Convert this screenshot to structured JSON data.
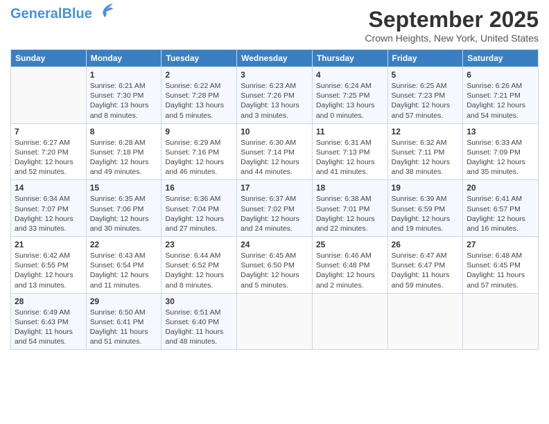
{
  "header": {
    "logo_general": "General",
    "logo_blue": "Blue",
    "month_year": "September 2025",
    "location": "Crown Heights, New York, United States"
  },
  "days_of_week": [
    "Sunday",
    "Monday",
    "Tuesday",
    "Wednesday",
    "Thursday",
    "Friday",
    "Saturday"
  ],
  "weeks": [
    [
      {
        "day": "",
        "info": ""
      },
      {
        "day": "1",
        "info": "Sunrise: 6:21 AM\nSunset: 7:30 PM\nDaylight: 13 hours\nand 8 minutes."
      },
      {
        "day": "2",
        "info": "Sunrise: 6:22 AM\nSunset: 7:28 PM\nDaylight: 13 hours\nand 5 minutes."
      },
      {
        "day": "3",
        "info": "Sunrise: 6:23 AM\nSunset: 7:26 PM\nDaylight: 13 hours\nand 3 minutes."
      },
      {
        "day": "4",
        "info": "Sunrise: 6:24 AM\nSunset: 7:25 PM\nDaylight: 13 hours\nand 0 minutes."
      },
      {
        "day": "5",
        "info": "Sunrise: 6:25 AM\nSunset: 7:23 PM\nDaylight: 12 hours\nand 57 minutes."
      },
      {
        "day": "6",
        "info": "Sunrise: 6:26 AM\nSunset: 7:21 PM\nDaylight: 12 hours\nand 54 minutes."
      }
    ],
    [
      {
        "day": "7",
        "info": "Sunrise: 6:27 AM\nSunset: 7:20 PM\nDaylight: 12 hours\nand 52 minutes."
      },
      {
        "day": "8",
        "info": "Sunrise: 6:28 AM\nSunset: 7:18 PM\nDaylight: 12 hours\nand 49 minutes."
      },
      {
        "day": "9",
        "info": "Sunrise: 6:29 AM\nSunset: 7:16 PM\nDaylight: 12 hours\nand 46 minutes."
      },
      {
        "day": "10",
        "info": "Sunrise: 6:30 AM\nSunset: 7:14 PM\nDaylight: 12 hours\nand 44 minutes."
      },
      {
        "day": "11",
        "info": "Sunrise: 6:31 AM\nSunset: 7:13 PM\nDaylight: 12 hours\nand 41 minutes."
      },
      {
        "day": "12",
        "info": "Sunrise: 6:32 AM\nSunset: 7:11 PM\nDaylight: 12 hours\nand 38 minutes."
      },
      {
        "day": "13",
        "info": "Sunrise: 6:33 AM\nSunset: 7:09 PM\nDaylight: 12 hours\nand 35 minutes."
      }
    ],
    [
      {
        "day": "14",
        "info": "Sunrise: 6:34 AM\nSunset: 7:07 PM\nDaylight: 12 hours\nand 33 minutes."
      },
      {
        "day": "15",
        "info": "Sunrise: 6:35 AM\nSunset: 7:06 PM\nDaylight: 12 hours\nand 30 minutes."
      },
      {
        "day": "16",
        "info": "Sunrise: 6:36 AM\nSunset: 7:04 PM\nDaylight: 12 hours\nand 27 minutes."
      },
      {
        "day": "17",
        "info": "Sunrise: 6:37 AM\nSunset: 7:02 PM\nDaylight: 12 hours\nand 24 minutes."
      },
      {
        "day": "18",
        "info": "Sunrise: 6:38 AM\nSunset: 7:01 PM\nDaylight: 12 hours\nand 22 minutes."
      },
      {
        "day": "19",
        "info": "Sunrise: 6:39 AM\nSunset: 6:59 PM\nDaylight: 12 hours\nand 19 minutes."
      },
      {
        "day": "20",
        "info": "Sunrise: 6:41 AM\nSunset: 6:57 PM\nDaylight: 12 hours\nand 16 minutes."
      }
    ],
    [
      {
        "day": "21",
        "info": "Sunrise: 6:42 AM\nSunset: 6:55 PM\nDaylight: 12 hours\nand 13 minutes."
      },
      {
        "day": "22",
        "info": "Sunrise: 6:43 AM\nSunset: 6:54 PM\nDaylight: 12 hours\nand 11 minutes."
      },
      {
        "day": "23",
        "info": "Sunrise: 6:44 AM\nSunset: 6:52 PM\nDaylight: 12 hours\nand 8 minutes."
      },
      {
        "day": "24",
        "info": "Sunrise: 6:45 AM\nSunset: 6:50 PM\nDaylight: 12 hours\nand 5 minutes."
      },
      {
        "day": "25",
        "info": "Sunrise: 6:46 AM\nSunset: 6:48 PM\nDaylight: 12 hours\nand 2 minutes."
      },
      {
        "day": "26",
        "info": "Sunrise: 6:47 AM\nSunset: 6:47 PM\nDaylight: 11 hours\nand 59 minutes."
      },
      {
        "day": "27",
        "info": "Sunrise: 6:48 AM\nSunset: 6:45 PM\nDaylight: 11 hours\nand 57 minutes."
      }
    ],
    [
      {
        "day": "28",
        "info": "Sunrise: 6:49 AM\nSunset: 6:43 PM\nDaylight: 11 hours\nand 54 minutes."
      },
      {
        "day": "29",
        "info": "Sunrise: 6:50 AM\nSunset: 6:41 PM\nDaylight: 11 hours\nand 51 minutes."
      },
      {
        "day": "30",
        "info": "Sunrise: 6:51 AM\nSunset: 6:40 PM\nDaylight: 11 hours\nand 48 minutes."
      },
      {
        "day": "",
        "info": ""
      },
      {
        "day": "",
        "info": ""
      },
      {
        "day": "",
        "info": ""
      },
      {
        "day": "",
        "info": ""
      }
    ]
  ]
}
